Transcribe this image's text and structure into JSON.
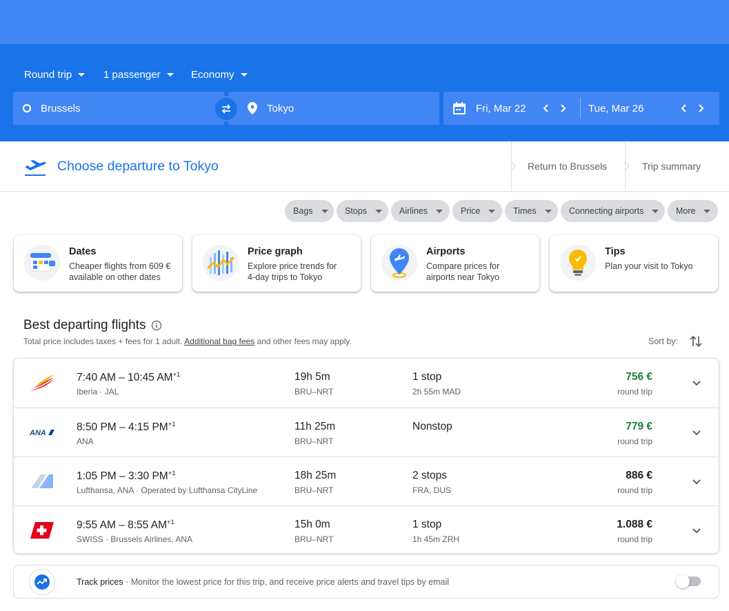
{
  "search": {
    "trip_type": "Round trip",
    "passengers": "1 passenger",
    "cabin": "Economy",
    "origin": "Brussels",
    "destination": "Tokyo",
    "depart_date": "Fri, Mar 22",
    "return_date": "Tue, Mar 26"
  },
  "steps": {
    "current": "Choose departure to Tokyo",
    "next": "Return to Brussels",
    "summary": "Trip summary"
  },
  "filters": [
    "Bags",
    "Stops",
    "Airlines",
    "Price",
    "Times",
    "Connecting airports",
    "More"
  ],
  "explore_cards": [
    {
      "title": "Dates",
      "desc1": "Cheaper flights from 609 €",
      "desc2": "available on other dates",
      "icon": "calendar-icon"
    },
    {
      "title": "Price graph",
      "desc1": "Explore price trends for",
      "desc2": "4-day trips to Tokyo",
      "icon": "price-graph-icon"
    },
    {
      "title": "Airports",
      "desc1": "Compare prices for",
      "desc2": "airports near Tokyo",
      "icon": "airport-pin-icon"
    },
    {
      "title": "Tips",
      "desc1": "Plan your visit to Tokyo",
      "desc2": "",
      "icon": "lightbulb-icon"
    }
  ],
  "results": {
    "title": "Best departing flights",
    "subtitle_pre": "Total price includes taxes + fees for 1 adult.",
    "subtitle_link": "Additional bag fees",
    "subtitle_post": "and other fees may apply.",
    "sort_label": "Sort by:",
    "flights": [
      {
        "depart": "7:40 AM",
        "arrive": "10:45 AM",
        "day_offset": "+1",
        "airlines": "Iberia ·  JAL",
        "duration": "19h 5m",
        "route": "BRU–NRT",
        "stops": "1 stop",
        "stop_detail": "2h 55m MAD",
        "price": "756 €",
        "price_type": "round trip",
        "highlight": true
      },
      {
        "depart": "8:50 PM",
        "arrive": "4:15 PM",
        "day_offset": "+1",
        "airlines": "ANA",
        "duration": "11h 25m",
        "route": "BRU–NRT",
        "stops": "Nonstop",
        "stop_detail": "",
        "price": "779 €",
        "price_type": "round trip",
        "highlight": true
      },
      {
        "depart": "1:05 PM",
        "arrive": "3:30 PM",
        "day_offset": "+1",
        "airlines": "Lufthansa, ANA · Operated by Lufthansa CityLine",
        "duration": "18h 25m",
        "route": "BRU–NRT",
        "stops": "2 stops",
        "stop_detail": "FRA, DUS",
        "price": "886 €",
        "price_type": "round trip",
        "highlight": false
      },
      {
        "depart": "9:55 AM",
        "arrive": "8:55 AM",
        "day_offset": "+1",
        "airlines": "SWISS ·  Brussels Airlines, ANA",
        "duration": "15h 0m",
        "route": "BRU–NRT",
        "stops": "1 stop",
        "stop_detail": "1h 45m ZRH",
        "price": "1.088 €",
        "price_type": "round trip",
        "highlight": false
      }
    ]
  },
  "track": {
    "label": "Track prices",
    "desc": "· Monitor the lowest price for this trip, and receive price alerts and travel tips by email",
    "enabled": false
  },
  "colors": {
    "brand_blue": "#1a73e8",
    "header_blue": "#4285f4",
    "price_green": "#188038"
  }
}
